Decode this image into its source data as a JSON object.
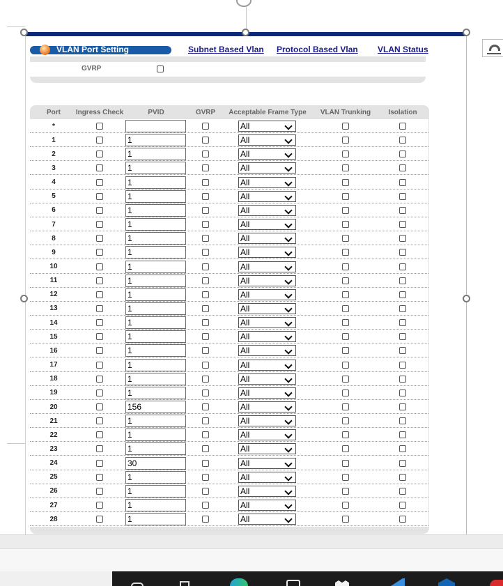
{
  "title": "VLAN Port Setting",
  "nav_links": [
    "Subnet Based Vlan",
    "Protocol Based Vlan",
    "VLAN Status"
  ],
  "gvrp_global": {
    "label": "GVRP",
    "checked": false
  },
  "columns": [
    "Port",
    "Ingress Check",
    "PVID",
    "GVRP",
    "Acceptable Frame Type",
    "VLAN Trunking",
    "Isolation"
  ],
  "frame_type_options": [
    "All"
  ],
  "rows": [
    {
      "port": "*",
      "pvid": "",
      "frame_type": "All"
    },
    {
      "port": "1",
      "pvid": "1",
      "frame_type": "All"
    },
    {
      "port": "2",
      "pvid": "1",
      "frame_type": "All"
    },
    {
      "port": "3",
      "pvid": "1",
      "frame_type": "All"
    },
    {
      "port": "4",
      "pvid": "1",
      "frame_type": "All"
    },
    {
      "port": "5",
      "pvid": "1",
      "frame_type": "All"
    },
    {
      "port": "6",
      "pvid": "1",
      "frame_type": "All"
    },
    {
      "port": "7",
      "pvid": "1",
      "frame_type": "All"
    },
    {
      "port": "8",
      "pvid": "1",
      "frame_type": "All"
    },
    {
      "port": "9",
      "pvid": "1",
      "frame_type": "All"
    },
    {
      "port": "10",
      "pvid": "1",
      "frame_type": "All"
    },
    {
      "port": "11",
      "pvid": "1",
      "frame_type": "All"
    },
    {
      "port": "12",
      "pvid": "1",
      "frame_type": "All"
    },
    {
      "port": "13",
      "pvid": "1",
      "frame_type": "All"
    },
    {
      "port": "14",
      "pvid": "1",
      "frame_type": "All"
    },
    {
      "port": "15",
      "pvid": "1",
      "frame_type": "All"
    },
    {
      "port": "16",
      "pvid": "1",
      "frame_type": "All"
    },
    {
      "port": "17",
      "pvid": "1",
      "frame_type": "All"
    },
    {
      "port": "18",
      "pvid": "1",
      "frame_type": "All"
    },
    {
      "port": "19",
      "pvid": "1",
      "frame_type": "All"
    },
    {
      "port": "20",
      "pvid": "156",
      "frame_type": "All"
    },
    {
      "port": "21",
      "pvid": "1",
      "frame_type": "All"
    },
    {
      "port": "22",
      "pvid": "1",
      "frame_type": "All"
    },
    {
      "port": "23",
      "pvid": "1",
      "frame_type": "All"
    },
    {
      "port": "24",
      "pvid": "30",
      "frame_type": "All"
    },
    {
      "port": "25",
      "pvid": "1",
      "frame_type": "All"
    },
    {
      "port": "26",
      "pvid": "1",
      "frame_type": "All"
    },
    {
      "port": "27",
      "pvid": "1",
      "frame_type": "All"
    },
    {
      "port": "28",
      "pvid": "1",
      "frame_type": "All"
    }
  ],
  "colors": {
    "title_bar": "#1a5ba8",
    "frame_top": "#0b2a7a",
    "link": "#1b1b8c",
    "panel": "#e3e3e3"
  }
}
